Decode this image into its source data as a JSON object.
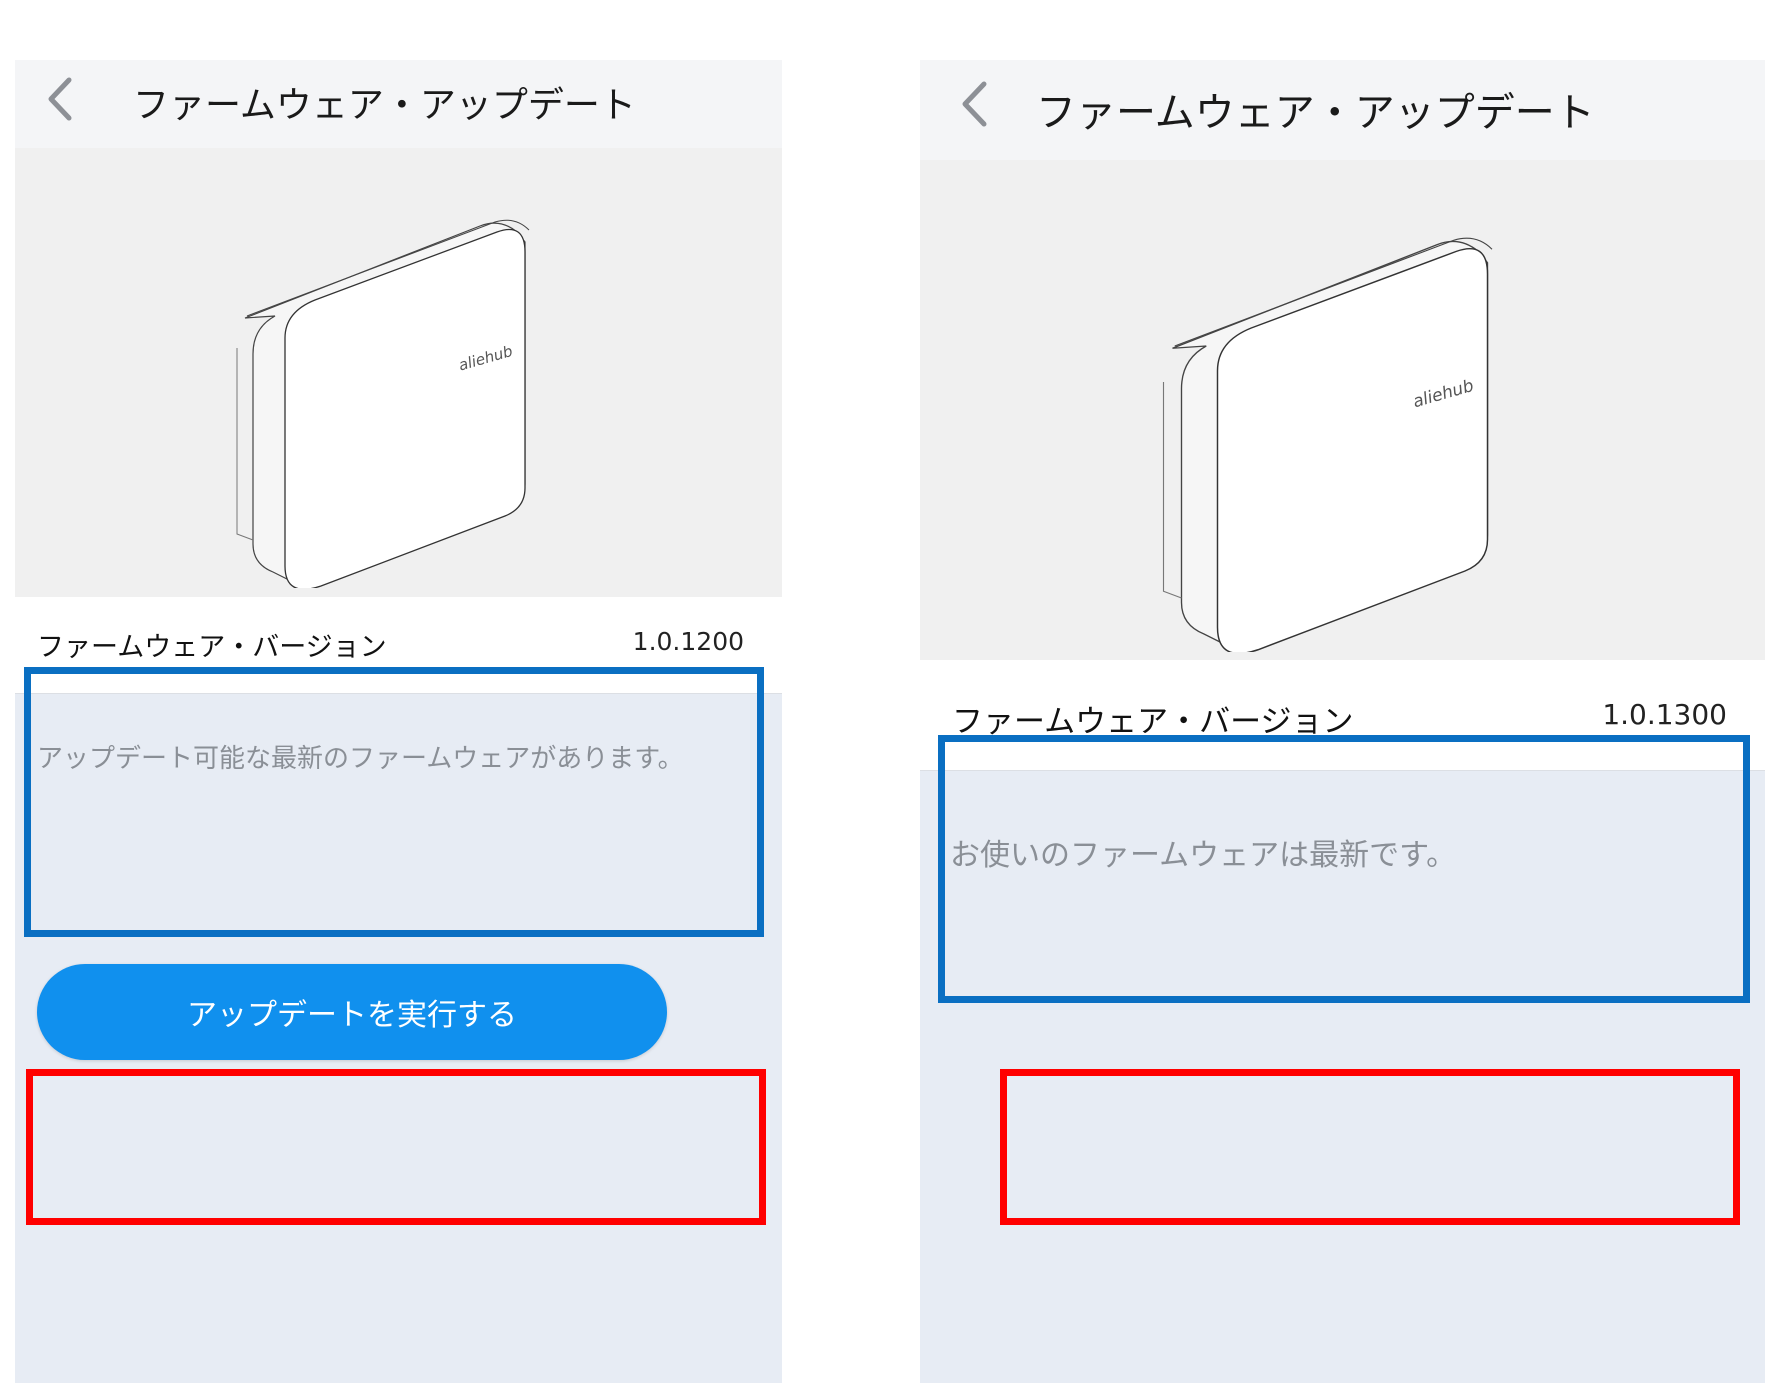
{
  "panels": [
    {
      "header": {
        "title": "ファームウェア・アップデート",
        "back_icon": "chevron-left-icon"
      },
      "device": {
        "brand": "aliehub"
      },
      "firmware": {
        "label": "ファームウェア・バージョン",
        "value": "1.0.1200"
      },
      "status_message": "アップデート可能な最新のファームウェアがあります。",
      "update_button": {
        "label": "アップデートを実行する"
      }
    },
    {
      "header": {
        "title": "ファームウェア・アップデート",
        "back_icon": "chevron-left-icon"
      },
      "device": {
        "brand": "aliehub"
      },
      "firmware": {
        "label": "ファームウェア・バージョン",
        "value": "1.0.1300"
      },
      "status_message": "お使いのファームウェアは最新です。"
    }
  ],
  "colors": {
    "highlight_blue": "#0a6fc2",
    "highlight_red": "#ff0000",
    "button_blue": "#1090ee"
  }
}
